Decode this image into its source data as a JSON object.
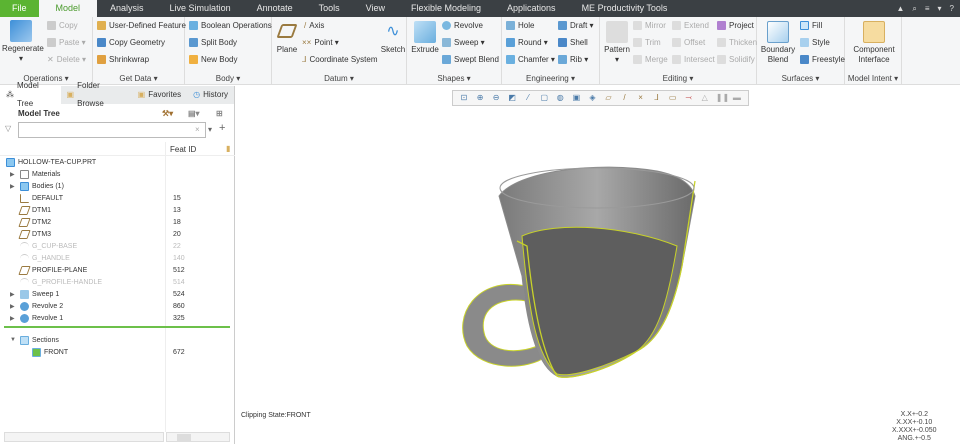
{
  "tabs": [
    "File",
    "Model",
    "Analysis",
    "Live Simulation",
    "Annotate",
    "Tools",
    "View",
    "Flexible Modeling",
    "Applications",
    "ME Productivity Tools"
  ],
  "ribbon": {
    "operations": {
      "label": "Operations ▾",
      "regenerate": "Regenerate",
      "copy": "Copy",
      "paste": "Paste ▾",
      "delete": "Delete ▾"
    },
    "get_data": {
      "label": "Get Data ▾",
      "udf": "User-Defined Feature",
      "copy_geometry": "Copy Geometry",
      "shrinkwrap": "Shrinkwrap"
    },
    "body": {
      "label": "Body ▾",
      "boolean": "Boolean Operations",
      "split": "Split Body",
      "new": "New Body"
    },
    "datum": {
      "label": "Datum ▾",
      "plane": "Plane",
      "axis": "Axis",
      "point": "Point ▾",
      "csys": "Coordinate System",
      "sketch": "Sketch"
    },
    "shapes": {
      "label": "Shapes ▾",
      "extrude": "Extrude",
      "revolve": "Revolve",
      "sweep": "Sweep ▾",
      "swept_blend": "Swept Blend"
    },
    "engineering": {
      "label": "Engineering ▾",
      "hole": "Hole",
      "round": "Round ▾",
      "chamfer": "Chamfer ▾",
      "draft": "Draft ▾",
      "shell": "Shell",
      "rib": "Rib ▾"
    },
    "editing": {
      "label": "Editing ▾",
      "pattern": "Pattern",
      "mirror": "Mirror",
      "trim": "Trim",
      "merge": "Merge",
      "extend": "Extend",
      "offset": "Offset",
      "intersect": "Intersect",
      "project": "Project",
      "thicken": "Thicken",
      "solidify": "Solidify"
    },
    "surfaces": {
      "label": "Surfaces ▾",
      "boundary": "Boundary Blend",
      "fill": "Fill",
      "style": "Style",
      "freestyle": "Freestyle"
    },
    "model_intent": {
      "label": "Model Intent ▾",
      "component_interface": "Component Interface"
    }
  },
  "left": {
    "tabs": [
      "Model Tree",
      "Folder Browse",
      "Favorites",
      "History"
    ],
    "title": "Model Tree",
    "filter_value": "",
    "col_feat_id": "Feat ID",
    "root": "HOLLOW-TEA-CUP.PRT",
    "rows": [
      {
        "name": "Materials",
        "id": "",
        "exp": true,
        "sup": false,
        "icon": "materials"
      },
      {
        "name": "Bodies (1)",
        "id": "",
        "exp": true,
        "sup": false,
        "icon": "bodies"
      },
      {
        "name": "DEFAULT",
        "id": "15",
        "exp": false,
        "sup": false,
        "icon": "csys"
      },
      {
        "name": "DTM1",
        "id": "13",
        "exp": false,
        "sup": false,
        "icon": "plane"
      },
      {
        "name": "DTM2",
        "id": "18",
        "exp": false,
        "sup": false,
        "icon": "plane"
      },
      {
        "name": "DTM3",
        "id": "20",
        "exp": false,
        "sup": false,
        "icon": "plane"
      },
      {
        "name": "G_CUP-BASE",
        "id": "22",
        "exp": false,
        "sup": true,
        "icon": "sketch"
      },
      {
        "name": "G_HANDLE",
        "id": "140",
        "exp": false,
        "sup": true,
        "icon": "sketch"
      },
      {
        "name": "PROFILE-PLANE",
        "id": "512",
        "exp": false,
        "sup": false,
        "icon": "plane"
      },
      {
        "name": "G_PROFILE-HANDLE",
        "id": "514",
        "exp": false,
        "sup": true,
        "icon": "sketch"
      },
      {
        "name": "Sweep 1",
        "id": "524",
        "exp": true,
        "sup": false,
        "icon": "sweep"
      },
      {
        "name": "Revolve 2",
        "id": "860",
        "exp": true,
        "sup": false,
        "icon": "revolve"
      },
      {
        "name": "Revolve 1",
        "id": "325",
        "exp": true,
        "sup": false,
        "icon": "revolve"
      }
    ],
    "sections": {
      "label": "Sections",
      "child": "FRONT",
      "child_id": "672"
    }
  },
  "graphics": {
    "clipping": "Clipping State:FRONT",
    "tolerances": [
      "X.X+-0.2",
      "X.XX+-0.10",
      "X.XXX+-0.050",
      "ANG.+-0.5"
    ]
  },
  "colors": {
    "accent": "#5bb432",
    "tabbar": "#3b4044",
    "edge": "#c8d22a"
  }
}
